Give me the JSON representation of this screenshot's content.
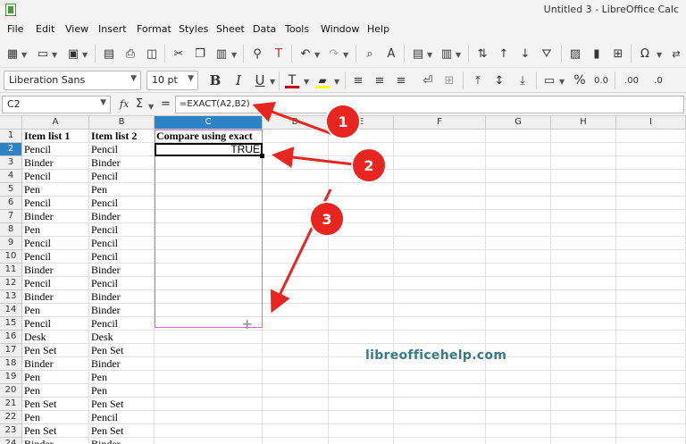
{
  "window": {
    "title": "Untitled 3 - LibreOffice Calc"
  },
  "menu": [
    "File",
    "Edit",
    "View",
    "Insert",
    "Format",
    "Styles",
    "Sheet",
    "Data",
    "Tools",
    "Window",
    "Help"
  ],
  "toolbar": {
    "font_name": "Liberation Sans",
    "font_size": "10 pt",
    "bold_label": "B",
    "italic_label": "I",
    "underline_label": "U",
    "percent_label": "%",
    "decimal_label": "0.0",
    "decimal_add_label": ".00",
    "decimal_remove_label": ".0",
    "text_color": "#cc0000",
    "highlight_color": "#ffff00"
  },
  "formula_bar": {
    "cell_ref": "C2",
    "fx_label": "fx",
    "sum_label": "Σ",
    "equals_label": "=",
    "formula": "=EXACT(A2,B2)"
  },
  "columns": [
    "A",
    "B",
    "C",
    "D",
    "E",
    "F",
    "G",
    "H",
    "I"
  ],
  "active_column": "C",
  "active_row": "2",
  "rows": [
    {
      "n": "1",
      "a": "Item list 1",
      "b": "Item list 2",
      "c": "Compare using exact"
    },
    {
      "n": "2",
      "a": "Pencil",
      "b": "Pencil",
      "c": "TRUE"
    },
    {
      "n": "3",
      "a": "Binder",
      "b": "Binder",
      "c": ""
    },
    {
      "n": "4",
      "a": "Pencil",
      "b": "Pencil",
      "c": ""
    },
    {
      "n": "5",
      "a": "Pen",
      "b": "Pen",
      "c": ""
    },
    {
      "n": "6",
      "a": "Pencil",
      "b": "Pencil",
      "c": ""
    },
    {
      "n": "7",
      "a": "Binder",
      "b": "Binder",
      "c": ""
    },
    {
      "n": "8",
      "a": "Pen",
      "b": "Pencil",
      "c": ""
    },
    {
      "n": "9",
      "a": "Pencil",
      "b": "Pencil",
      "c": ""
    },
    {
      "n": "10",
      "a": "Pencil",
      "b": "Pencil",
      "c": ""
    },
    {
      "n": "11",
      "a": "Binder",
      "b": "Binder",
      "c": ""
    },
    {
      "n": "12",
      "a": "Pencil",
      "b": "Pencil",
      "c": ""
    },
    {
      "n": "13",
      "a": "Binder",
      "b": "Binder",
      "c": ""
    },
    {
      "n": "14",
      "a": "Pen",
      "b": "Binder",
      "c": ""
    },
    {
      "n": "15",
      "a": "Pencil",
      "b": "Pencil",
      "c": ""
    },
    {
      "n": "16",
      "a": "Desk",
      "b": "Desk",
      "c": ""
    },
    {
      "n": "17",
      "a": "Pen Set",
      "b": "Pen Set",
      "c": ""
    },
    {
      "n": "18",
      "a": "Binder",
      "b": "Binder",
      "c": ""
    },
    {
      "n": "19",
      "a": "Pen",
      "b": "Pen",
      "c": ""
    },
    {
      "n": "20",
      "a": "Pen",
      "b": "Pen",
      "c": ""
    },
    {
      "n": "21",
      "a": "Pen Set",
      "b": "Pen Set",
      "c": ""
    },
    {
      "n": "22",
      "a": "Pen",
      "b": "Pencil",
      "c": ""
    },
    {
      "n": "23",
      "a": "Pen Set",
      "b": "Pen Set",
      "c": ""
    },
    {
      "n": "24",
      "a": "Binder",
      "b": "Binder",
      "c": ""
    }
  ],
  "annotations": {
    "badges": [
      "1",
      "2",
      "3"
    ],
    "color": "#e8251f"
  },
  "watermark": "libreofficehelp.com"
}
